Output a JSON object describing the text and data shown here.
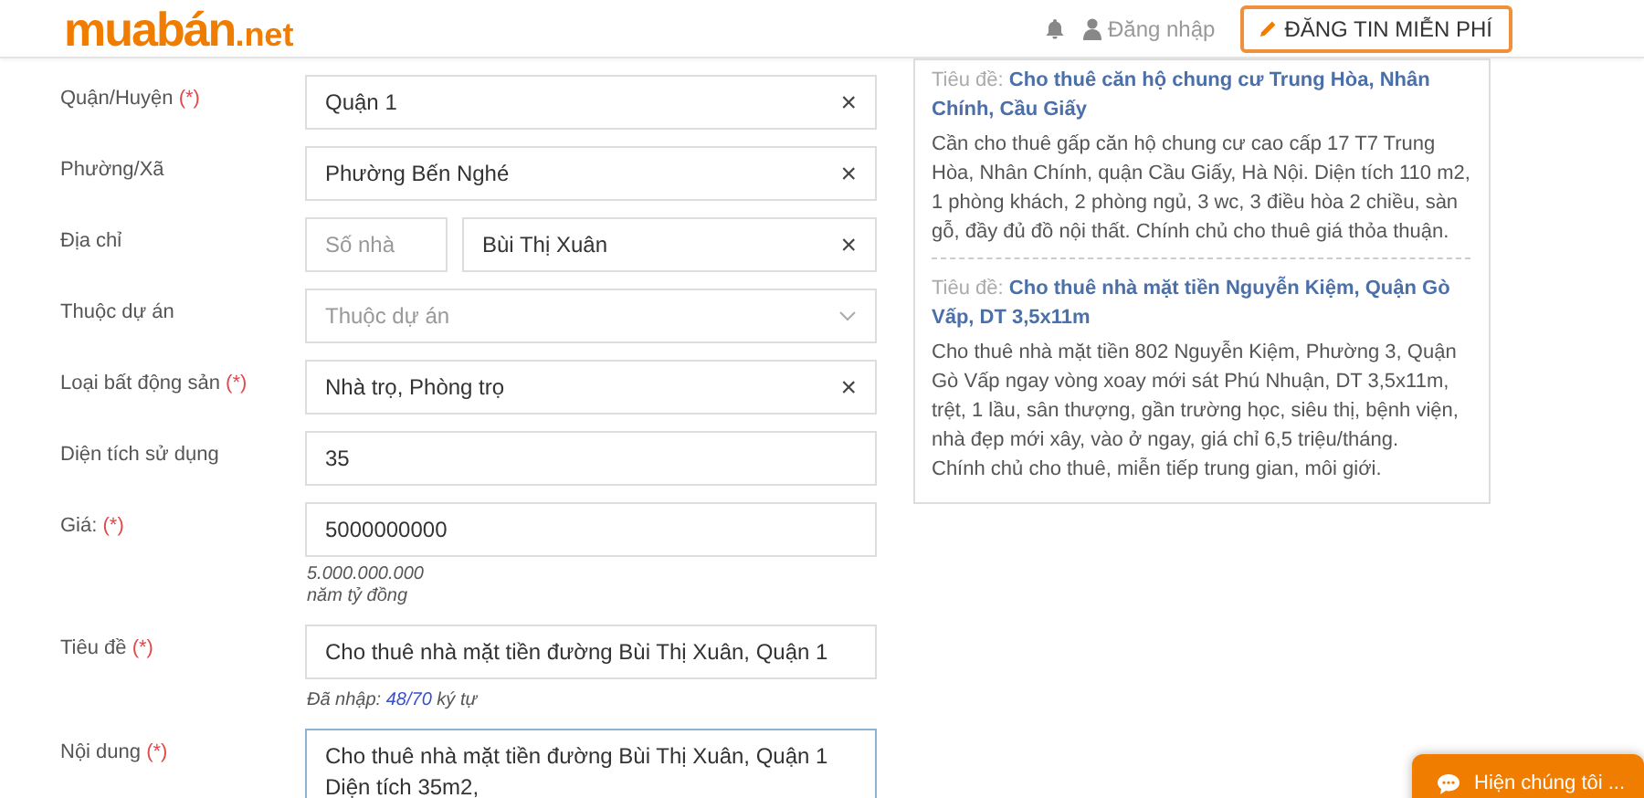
{
  "header": {
    "logo": {
      "main": "muabán",
      "suffix": ".net"
    },
    "login": "Đăng nhập",
    "post_button": "ĐĂNG TIN MIỄN PHÍ"
  },
  "form": {
    "rows": [
      {
        "kind": "select_clear",
        "label": "Quận/Huyện",
        "required_mark": "(*)",
        "value": "Quận 1",
        "clear": "×"
      },
      {
        "kind": "select_clear",
        "label": "Phường/Xã",
        "value": "Phường Bến Nghé",
        "clear": "×"
      },
      {
        "kind": "address",
        "label": "Địa chỉ",
        "number_placeholder": "Số nhà",
        "value": "Bùi Thị Xuân",
        "clear": "×"
      },
      {
        "kind": "dropdown",
        "label": "Thuộc dự án",
        "placeholder": "Thuộc dự án"
      },
      {
        "kind": "select_clear",
        "label": "Loại bất động sản",
        "required_mark": "(*)",
        "value": "Nhà trọ, Phòng trọ",
        "clear": "×"
      },
      {
        "kind": "text",
        "label": "Diện tích sử dụng",
        "value": "35"
      },
      {
        "kind": "text",
        "label": "Giá:",
        "required_mark": "(*)",
        "value": "5000000000",
        "hints": [
          "5.000.000.000",
          "năm tỷ đồng"
        ]
      },
      {
        "kind": "text",
        "label": "Tiêu đề",
        "required_mark": "(*)",
        "value": "Cho thuê nhà mặt tiền đường Bùi Thị Xuân, Quận 1",
        "counter": {
          "prefix": "Đã nhập:",
          "count": "48/70",
          "suffix": "ký tự"
        }
      },
      {
        "kind": "textarea",
        "label": "Nội dung",
        "required_mark": "(*)",
        "value": "Cho thuê nhà mặt tiền đường Bùi Thị Xuân, Quận 1\nDiện tích 35m2,"
      }
    ]
  },
  "examples": [
    {
      "title_label": "Tiêu đề:",
      "title": "Cho thuê căn hộ chung cư Trung Hòa, Nhân Chính, Cầu Giấy",
      "body": "Cần cho thuê gấp căn hộ chung cư cao cấp 17 T7 Trung Hòa, Nhân Chính, quận Cầu Giấy, Hà Nội. Diện tích 110 m2, 1 phòng khách, 2 phòng ngủ, 3 wc, 3 điều hòa 2 chiều, sàn gỗ, đầy đủ đồ nội thất. Chính chủ cho thuê giá thỏa thuận."
    },
    {
      "title_label": "Tiêu đề:",
      "title": "Cho thuê nhà mặt tiền Nguyễn Kiệm, Quận Gò Vấp, DT 3,5x11m",
      "body": "Cho thuê nhà mặt tiền 802 Nguyễn Kiệm, Phường 3, Quận Gò Vấp ngay vòng xoay mới sát Phú Nhuận, DT 3,5x11m, trệt, 1 lầu, sân thượng, gần trường học, siêu thị, bệnh viện, nhà đẹp mới xây, vào ở ngay, giá chỉ 6,5 triệu/tháng.\nChính chủ cho thuê, miễn tiếp trung gian, môi giới."
    }
  ],
  "chat_button": "Hiện chúng tôi ..."
}
